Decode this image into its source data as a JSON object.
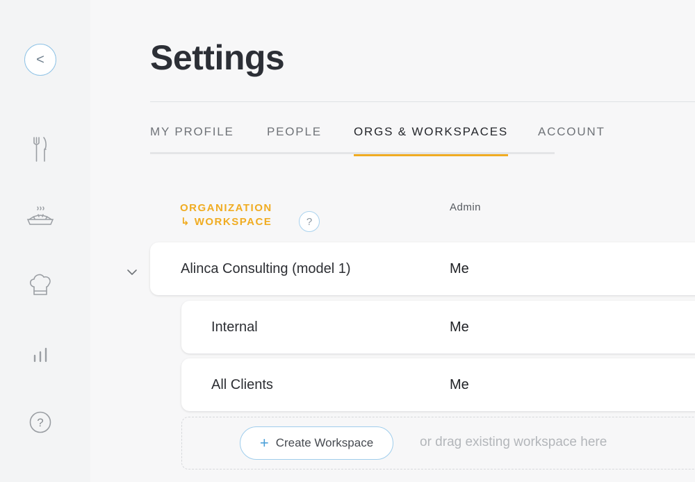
{
  "sidebar": {
    "back_label": "<",
    "items": [
      {
        "icon": "fork-knife-icon"
      },
      {
        "icon": "pie-icon"
      },
      {
        "icon": "chef-hat-icon"
      },
      {
        "icon": "bar-chart-icon"
      },
      {
        "icon": "help-icon",
        "label": "?"
      }
    ]
  },
  "page": {
    "title": "Settings"
  },
  "tabs": [
    {
      "label": "MY PROFILE",
      "active": false
    },
    {
      "label": "PEOPLE",
      "active": false
    },
    {
      "label": "ORGS & WORKSPACES",
      "active": true
    },
    {
      "label": "ACCOUNT",
      "active": false
    }
  ],
  "table": {
    "header_org": "ORGANIZATION",
    "header_ws": "↳ WORKSPACE",
    "header_help": "?",
    "header_admin": "Admin",
    "organization": {
      "name": "Alinca Consulting (model 1)",
      "admin": "Me"
    },
    "workspaces": [
      {
        "name": "Internal",
        "admin": "Me"
      },
      {
        "name": "All Clients",
        "admin": "Me"
      }
    ],
    "create_button": "Create Workspace",
    "create_plus": "+",
    "drop_hint": "or drag existing workspace here"
  },
  "colors": {
    "accent": "#f0ac22",
    "link_border": "#9fcdec",
    "plus": "#4a9fd8"
  }
}
